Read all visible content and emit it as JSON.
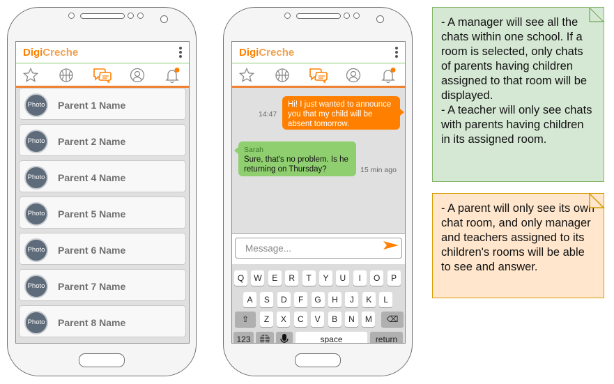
{
  "app": {
    "brand_part1": "Digi",
    "brand_part2": "Creche"
  },
  "nav_icons": [
    "star-icon",
    "basketball-icon",
    "chat-icon",
    "profile-icon",
    "bell-icon"
  ],
  "colors": {
    "accent": "#ff8000",
    "green_bubble": "#8fcf6f",
    "note_green": "#d5e8d4",
    "note_orange": "#ffe6cc"
  },
  "chat_list": {
    "avatar_label": "Photo",
    "items": [
      {
        "name": "Parent 1 Name"
      },
      {
        "name": "Parent 2 Name"
      },
      {
        "name": "Parent 4 Name"
      },
      {
        "name": "Parent 5 Name"
      },
      {
        "name": "Parent 6 Name"
      },
      {
        "name": "Parent 7 Name"
      },
      {
        "name": "Parent 8 Name"
      }
    ]
  },
  "conversation": {
    "outgoing": {
      "text": "Hi! I just wanted to announce you that my child will be absent tomorrow.",
      "time": "14:47"
    },
    "incoming": {
      "sender": "Sarah",
      "text": "Sure, that's no problem. Is he returning on Thursday?",
      "time": "15 min ago"
    },
    "input_placeholder": "Message..."
  },
  "keyboard": {
    "row1": [
      "Q",
      "W",
      "E",
      "R",
      "T",
      "Y",
      "U",
      "I",
      "O",
      "P"
    ],
    "row2": [
      "A",
      "S",
      "D",
      "F",
      "G",
      "H",
      "J",
      "K",
      "L"
    ],
    "row3": [
      "Z",
      "X",
      "C",
      "V",
      "B",
      "N",
      "M"
    ],
    "key_123": "123",
    "key_space": "space",
    "key_return": "return"
  },
  "notes": {
    "manager_teacher": "- A manager will see all the chats within one school. If a room is selected, only chats of parents having children assigned to that room will be displayed.\n- A teacher will only see chats with parents having children in its assigned room.",
    "parent": "- A parent will only see its own chat room, and only manager and teachers assigned to its children's rooms will be able to see and answer."
  }
}
